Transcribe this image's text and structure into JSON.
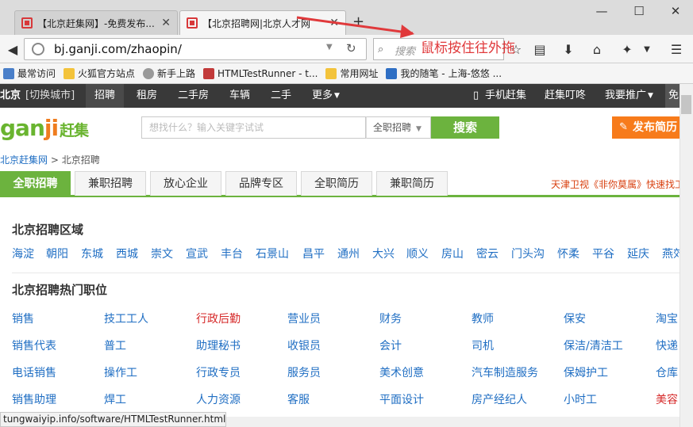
{
  "browser": {
    "tabs": [
      {
        "title": "【北京赶集网】-免费发布..."
      },
      {
        "title": "【北京招聘网|北京人才网"
      }
    ],
    "new_tab": "+",
    "window_controls": {
      "minimize": "—",
      "maximize": "☐",
      "close": "✕"
    },
    "url": "bj.ganji.com/zhaopin/",
    "search_placeholder": "搜索",
    "annotation": "鼠标按住往外拖",
    "bookmarks": [
      "最常访问",
      "火狐官方站点",
      "新手上路",
      "HTMLTestRunner - t...",
      "常用网址",
      "我的随笔 - 上海-悠悠 ..."
    ],
    "status_url": "tungwaiyip.info/software/HTMLTestRunner.html"
  },
  "site": {
    "city": "北京",
    "switch_city": "[切换城市]",
    "top_nav": [
      "招聘",
      "租房",
      "二手房",
      "车辆",
      "二手",
      "更多"
    ],
    "top_right": [
      "手机赶集",
      "赶集叮咚",
      "我要推广",
      "免"
    ],
    "logo": {
      "text": "gan",
      "j": "ji",
      "cn": "赶集"
    },
    "search_placeholder": "想找什么？输入关键字试试",
    "search_category": "全职招聘",
    "search_button": "搜索",
    "publish_button": "发布简历",
    "breadcrumb": [
      "北京赶集网",
      "北京招聘"
    ],
    "breadcrumb_sep": ">",
    "sub_tabs": [
      "全职招聘",
      "兼职招聘",
      "放心企业",
      "品牌专区",
      "全职简历",
      "兼职简历"
    ],
    "promo": "天津卫视《非你莫属》快速找工",
    "district_title": "北京招聘区域",
    "districts": [
      "海淀",
      "朝阳",
      "东城",
      "西城",
      "崇文",
      "宣武",
      "丰台",
      "石景山",
      "昌平",
      "通州",
      "大兴",
      "顺义",
      "房山",
      "密云",
      "门头沟",
      "怀柔",
      "平谷",
      "延庆",
      "燕郊"
    ],
    "hot_title": "北京招聘热门职位",
    "jobs": [
      [
        "销售",
        "技工工人",
        "行政后勤",
        "营业员",
        "财务",
        "教师",
        "保安",
        "淘宝"
      ],
      [
        "销售代表",
        "普工",
        "助理秘书",
        "收银员",
        "会计",
        "司机",
        "保洁/清洁工",
        "快递"
      ],
      [
        "电话销售",
        "操作工",
        "行政专员",
        "服务员",
        "美术创意",
        "汽车制造服务",
        "保姆护工",
        "仓库"
      ],
      [
        "销售助理",
        "焊工",
        "人力资源",
        "客服",
        "平面设计",
        "房产经纪人",
        "小时工",
        "美容"
      ]
    ]
  },
  "colors": {
    "green": "#6cb33e",
    "orange": "#f77b1b",
    "link": "#1f6ec3",
    "red": "#d62a2a"
  }
}
